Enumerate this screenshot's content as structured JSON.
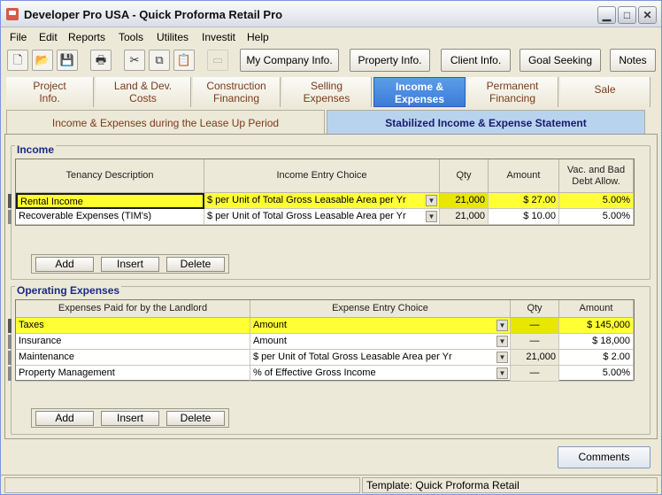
{
  "window": {
    "title": "Developer Pro  USA - Quick Proforma Retail Pro",
    "min_glyph": "▁",
    "max_glyph": "□",
    "close_glyph": "✕"
  },
  "menu": [
    "File",
    "Edit",
    "Reports",
    "Tools",
    "Utilites",
    "Investit",
    "Help"
  ],
  "toolbar": {
    "icons": [
      {
        "name": "new-icon",
        "glyph": "🗋"
      },
      {
        "name": "open-icon",
        "glyph": "📂"
      },
      {
        "name": "save-icon",
        "glyph": "💾"
      },
      {
        "name": "print-icon",
        "glyph": "🖶"
      },
      {
        "name": "cut-icon",
        "glyph": "✂"
      },
      {
        "name": "copy-icon",
        "glyph": "⧉"
      },
      {
        "name": "paste-icon",
        "glyph": "📋"
      },
      {
        "name": "disabled-tool-icon",
        "glyph": "▭"
      }
    ],
    "buttons": [
      "My Company Info.",
      "Property Info.",
      "Client Info.",
      "Goal Seeking",
      "Notes"
    ]
  },
  "tabs": [
    {
      "l1": "Project",
      "l2": "Info."
    },
    {
      "l1": "Land & Dev.",
      "l2": "Costs"
    },
    {
      "l1": "Construction",
      "l2": "Financing"
    },
    {
      "l1": "Selling",
      "l2": "Expenses"
    },
    {
      "l1": "Income &",
      "l2": "Expenses"
    },
    {
      "l1": "Permanent",
      "l2": "Financing"
    },
    {
      "l1": "Sale",
      "l2": ""
    }
  ],
  "subtabs": [
    "Income & Expenses during the Lease Up Period",
    "Stabilized Income & Expense Statement"
  ],
  "income": {
    "title": "Income",
    "headers": [
      "Tenancy Description",
      "Income Entry Choice",
      "Qty",
      "Amount",
      "Vac. and Bad Debt Allow."
    ],
    "rows": [
      {
        "desc": "Rental Income",
        "choice": "$ per Unit of Total Gross Leasable Area per Yr",
        "qty": "21,000",
        "amount": "$ 27.00",
        "vac": "5.00%"
      },
      {
        "desc": "Recoverable Expenses (TIM's)",
        "choice": "$ per Unit of Total Gross Leasable Area per Yr",
        "qty": "21,000",
        "amount": "$ 10.00",
        "vac": "5.00%"
      }
    ],
    "buttons": [
      "Add",
      "Insert",
      "Delete"
    ]
  },
  "expenses": {
    "title": "Operating Expenses",
    "headers": [
      "Expenses Paid for by the Landlord",
      "Expense Entry Choice",
      "Qty",
      "Amount"
    ],
    "rows": [
      {
        "desc": "Taxes",
        "choice": "Amount",
        "qty": "—",
        "amount": "$ 145,000"
      },
      {
        "desc": "Insurance",
        "choice": "Amount",
        "qty": "—",
        "amount": "$ 18,000"
      },
      {
        "desc": "Maintenance",
        "choice": "$ per Unit of Total Gross Leasable Area per Yr",
        "qty": "21,000",
        "amount": "$ 2.00"
      },
      {
        "desc": "Property Management",
        "choice": "% of Effective Gross Income",
        "qty": "—",
        "amount": "5.00%"
      }
    ],
    "buttons": [
      "Add",
      "Insert",
      "Delete"
    ]
  },
  "comments_label": "Comments",
  "status": {
    "template": "Template: Quick Proforma Retail"
  }
}
